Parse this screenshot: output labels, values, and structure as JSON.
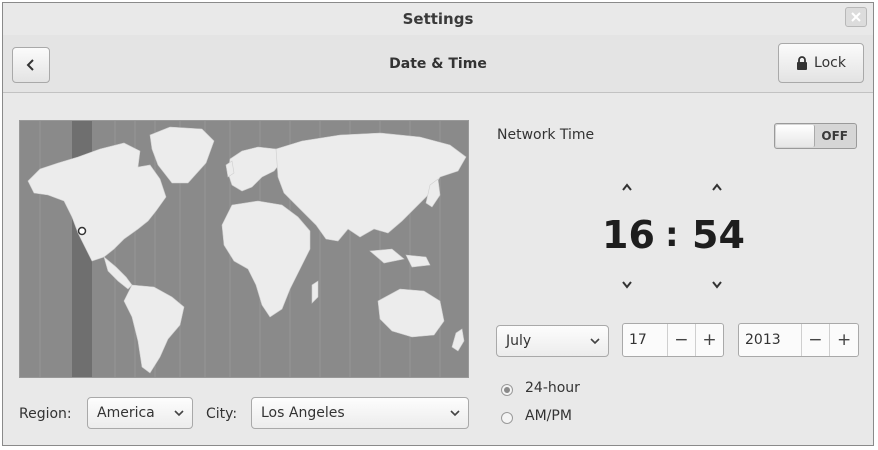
{
  "window": {
    "title": "Settings"
  },
  "header": {
    "page_title": "Date & Time",
    "lock_label": "Lock"
  },
  "network_time": {
    "label": "Network Time",
    "state": "OFF"
  },
  "clock": {
    "hours": "16",
    "separator": ":",
    "minutes": "54"
  },
  "date": {
    "month": "July",
    "day": "17",
    "year": "2013"
  },
  "format": {
    "option_24": "24-hour",
    "option_ampm": "AM/PM",
    "selected": "24-hour"
  },
  "location": {
    "region_label": "Region:",
    "region_value": "America",
    "city_label": "City:",
    "city_value": "Los Angeles"
  },
  "spin_controls": {
    "minus": "−",
    "plus": "+"
  },
  "icons": {
    "back": "chevron-left-icon",
    "lock": "lock-icon",
    "close": "close-icon",
    "up": "chevron-up-icon",
    "down": "chevron-down-icon",
    "marker": "location-pin-icon"
  },
  "colors": {
    "window_bg": "#e9e9e9",
    "map_bg": "#888888",
    "land": "#ececec",
    "timezone_band": "#6f6f6f"
  }
}
